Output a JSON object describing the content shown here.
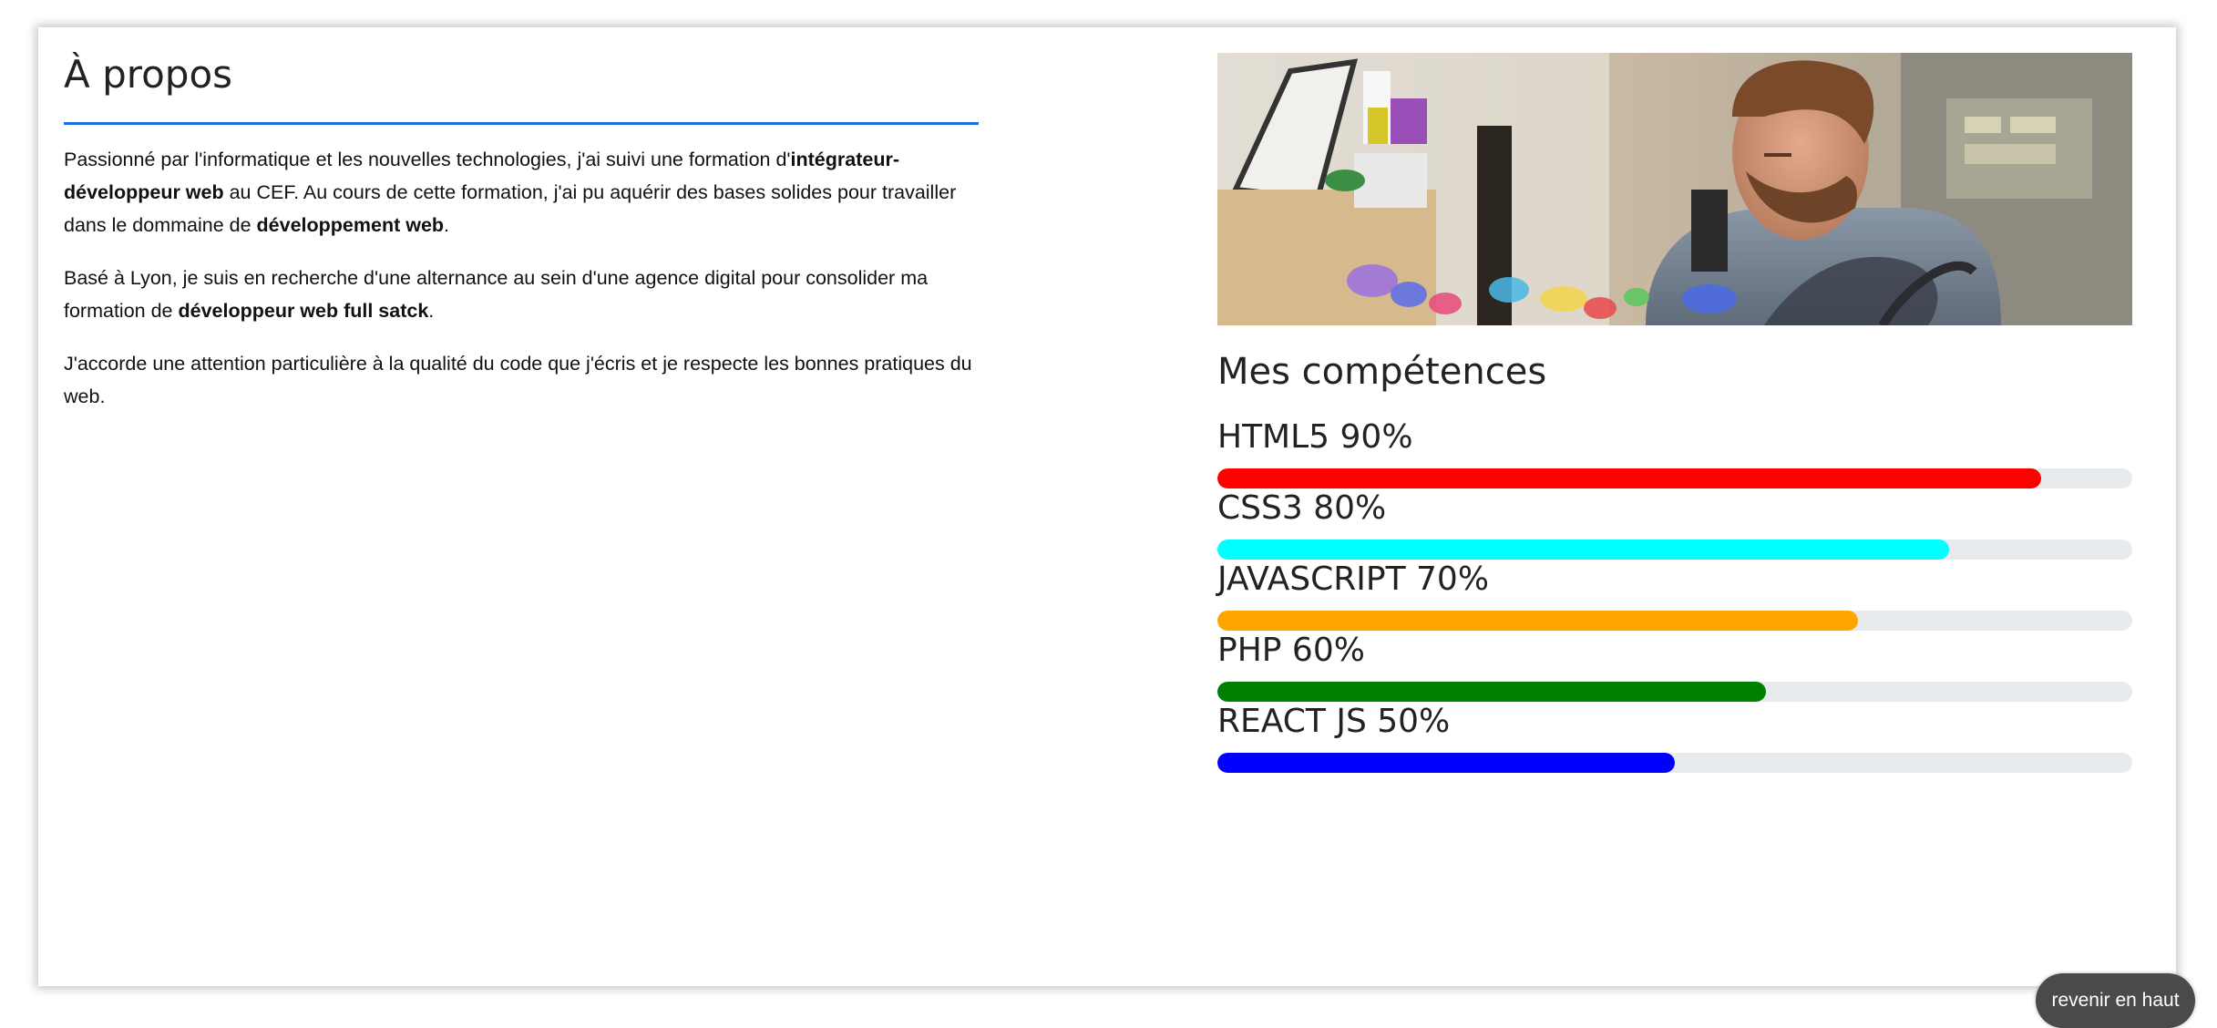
{
  "about": {
    "title": "À propos",
    "p1_a": "Passionné par l'informatique et les nouvelles technologies, j'ai suivi une formation d'",
    "p1_b": "intégrateur-développeur web",
    "p1_c": " au CEF. Au cours de cette formation, j'ai pu aquérir des bases solides pour travailler dans le dommaine de ",
    "p1_d": "développement web",
    "p1_e": ".",
    "p2_a": "Basé à Lyon, je suis en recherche d'une alternance au sein d'une agence digital pour consolider ma formation de ",
    "p2_b": "développeur web full satck",
    "p2_c": ".",
    "p3": "J'accorde une attention particulière à la qualité du code que j'écris et je respecte les bonnes pratiques du web."
  },
  "photo": {
    "subject": "developer-at-desk-photo"
  },
  "skills": {
    "title": "Mes compétences",
    "items": [
      {
        "label": "HTML5 90%",
        "percent": 90,
        "color": "#ff0000"
      },
      {
        "label": "CSS3 80%",
        "percent": 80,
        "color": "#00ffff"
      },
      {
        "label": "JAVASCRIPT 70%",
        "percent": 70,
        "color": "#ffa500"
      },
      {
        "label": "PHP 60%",
        "percent": 60,
        "color": "#008000"
      },
      {
        "label": "REACT JS 50%",
        "percent": 50,
        "color": "#0000ff"
      }
    ]
  },
  "back_to_top": {
    "label": "revenir en haut"
  }
}
